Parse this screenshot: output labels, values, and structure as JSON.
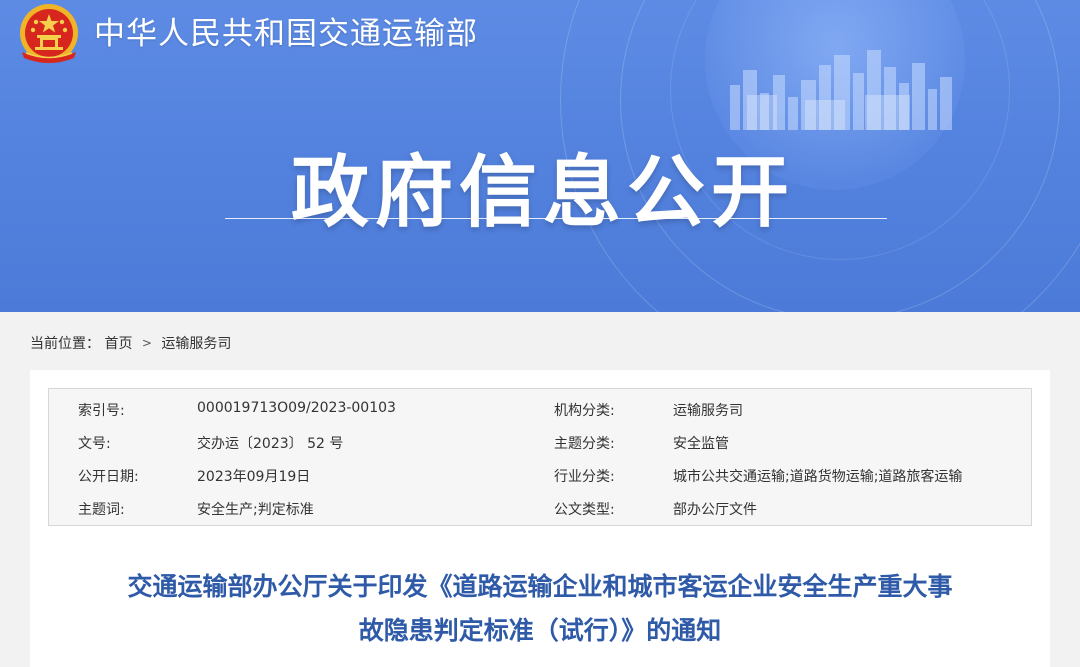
{
  "header": {
    "ministry_name": "中华人民共和国交通运输部",
    "banner_title": "政府信息公开"
  },
  "breadcrumb": {
    "prefix": "当前位置：",
    "items": [
      "首页",
      "运输服务司"
    ],
    "separator": ">"
  },
  "meta": {
    "index_label": "索引号:",
    "index_value": "000019713O09/2023-00103",
    "org_label": "机构分类:",
    "org_value": "运输服务司",
    "doc_no_label": "文号:",
    "doc_no_value": "交办运〔2023〕 52 号",
    "topic_label": "主题分类:",
    "topic_value": "安全监管",
    "date_label": "公开日期:",
    "date_value": "2023年09月19日",
    "industry_label": "行业分类:",
    "industry_value": "城市公共交通运输;道路货物运输;道路旅客运输",
    "keyword_label": "主题词:",
    "keyword_value": "安全生产;判定标准",
    "type_label": "公文类型:",
    "type_value": "部办公厅文件"
  },
  "document": {
    "title_line1": "交通运输部办公厅关于印发《道路运输企业和城市客运企业安全生产重大事",
    "title_line2": "故隐患判定标准（试行）》的通知"
  },
  "colors": {
    "banner_blue": "#5483df",
    "title_blue": "#2e5aa8",
    "emblem_red": "#d7261e",
    "emblem_gold": "#f4c430"
  },
  "icons": [
    "national-emblem-icon",
    "city-skyline-graphic"
  ]
}
